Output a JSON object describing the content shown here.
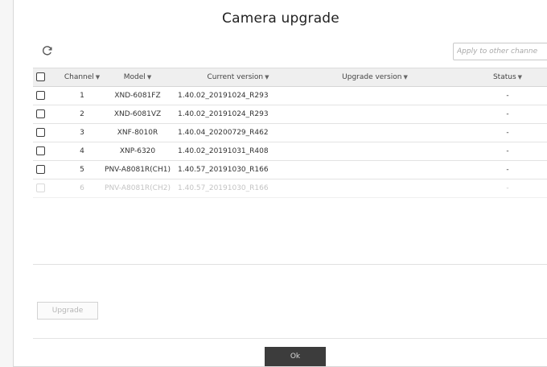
{
  "dialog": {
    "title": "Camera upgrade",
    "apply_placeholder": "Apply to other channe",
    "upgrade_label": "Upgrade",
    "ok_label": "Ok"
  },
  "table": {
    "headers": {
      "channel": "Channel",
      "model": "Model",
      "current_version": "Current version",
      "upgrade_version": "Upgrade version",
      "status": "Status"
    },
    "rows": [
      {
        "channel": "1",
        "model": "XND-6081FZ",
        "current_version": "1.40.02_20191024_R293",
        "status": "-"
      },
      {
        "channel": "2",
        "model": "XND-6081VZ",
        "current_version": "1.40.02_20191024_R293",
        "status": "-"
      },
      {
        "channel": "3",
        "model": "XNF-8010R",
        "current_version": "1.40.04_20200729_R462",
        "status": "-"
      },
      {
        "channel": "4",
        "model": "XNP-6320",
        "current_version": "1.40.02_20191031_R408",
        "status": "-"
      },
      {
        "channel": "5",
        "model": "PNV-A8081R(CH1)",
        "current_version": "1.40.57_20191030_R166",
        "status": "-"
      },
      {
        "channel": "6",
        "model": "PNV-A8081R(CH2)",
        "current_version": "1.40.57_20191030_R166",
        "status": "-"
      }
    ]
  },
  "icons": {
    "refresh": "refresh-icon",
    "search": "search-icon",
    "sort": "caret-down-icon"
  },
  "colors": {
    "ok_button": "#3c3c3c",
    "header_row": "#efefef"
  }
}
